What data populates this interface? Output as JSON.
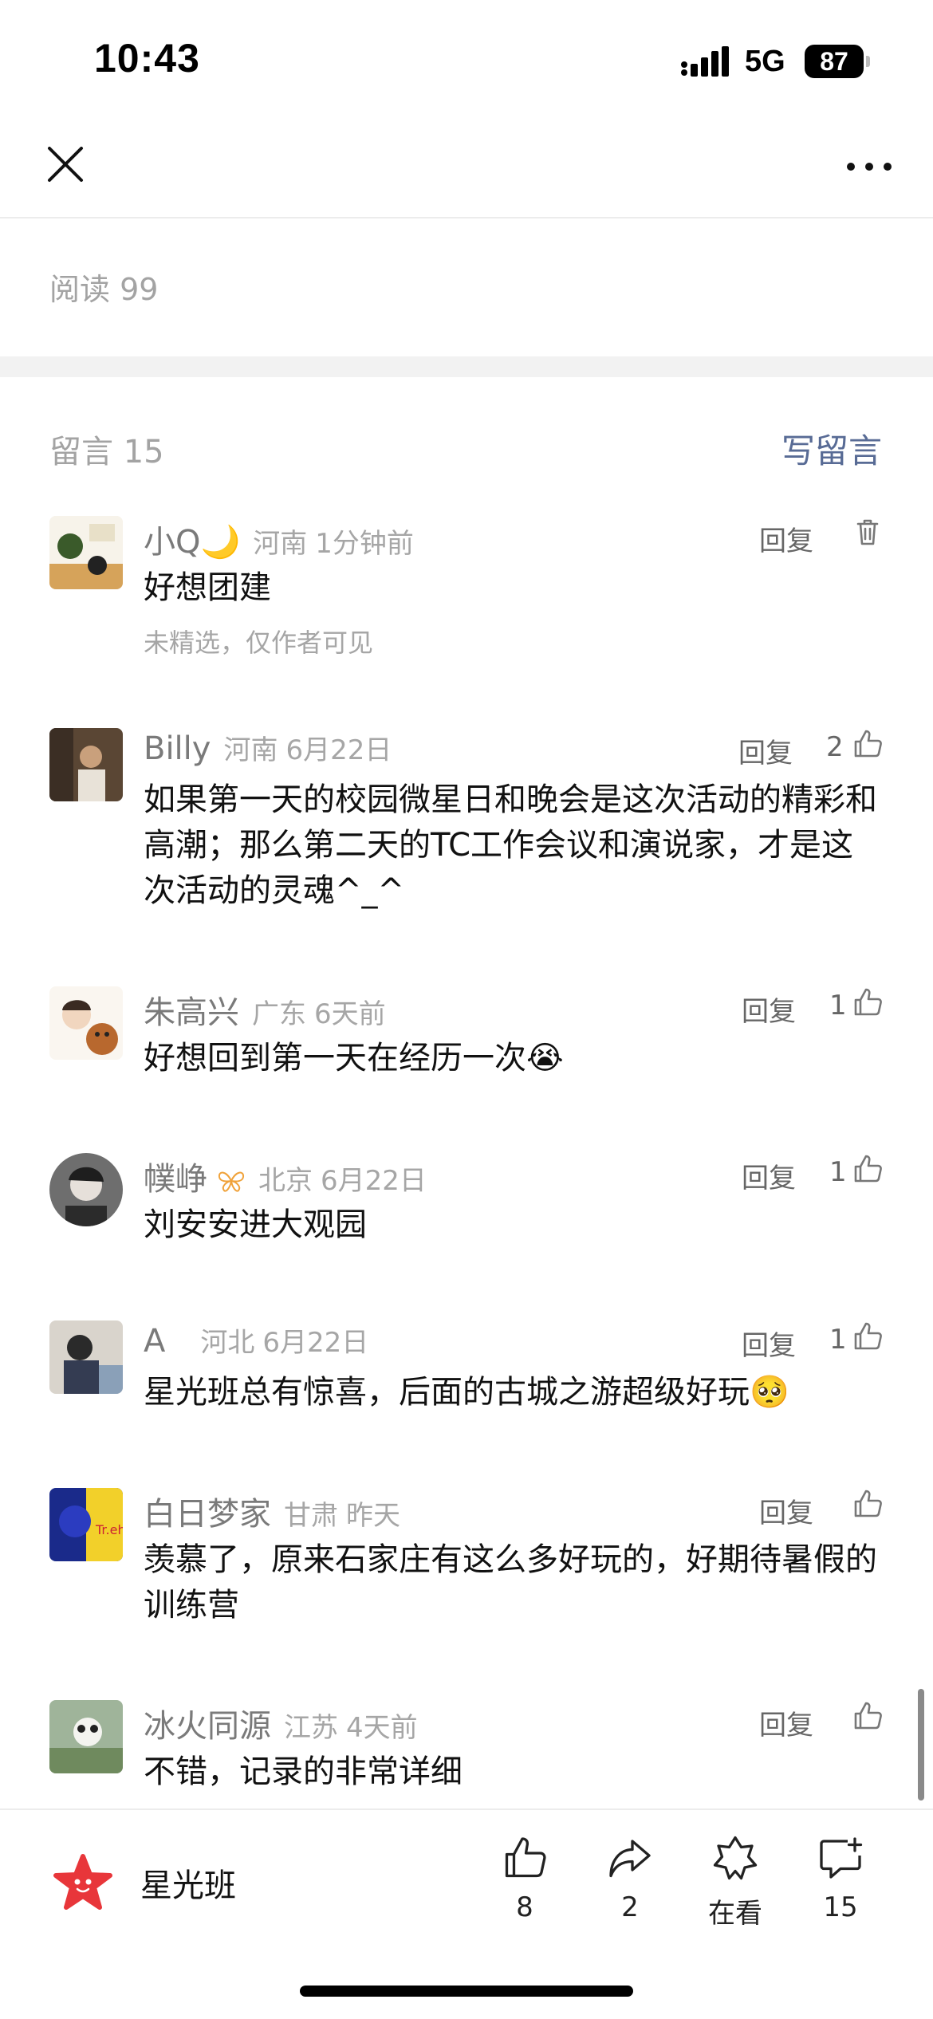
{
  "status_bar": {
    "time": "10:43",
    "network": "5G",
    "battery": "87"
  },
  "article": {
    "read_label": "阅读 99"
  },
  "comments_section": {
    "title": "留言 15",
    "write_label": "写留言",
    "comments": [
      {
        "name": "小Q🌙",
        "location": "河南",
        "time": "1分钟前",
        "reply": "回复",
        "likes": "",
        "text": "好想团建",
        "note": "未精选，仅作者可见"
      },
      {
        "name": "Billy",
        "location": "河南",
        "time": "6月22日",
        "reply": "回复",
        "likes": "2",
        "text": "如果第一天的校园微星日和晚会是这次活动的精彩和高潮；那么第二天的TC工作会议和演说家，才是这次活动的灵魂^_^"
      },
      {
        "name": "朱高兴",
        "location": "广东",
        "time": "6天前",
        "reply": "回复",
        "likes": "1",
        "text": "好想回到第一天在经历一次😭"
      },
      {
        "name": "幞峥",
        "location": "北京",
        "time": "6月22日",
        "reply": "回复",
        "likes": "1",
        "text": "刘安安进大观园"
      },
      {
        "name": "A",
        "location": "河北",
        "time": "6月22日",
        "reply": "回复",
        "likes": "1",
        "text": "星光班总有惊喜，后面的古城之游超级好玩🥺"
      },
      {
        "name": "白日梦家",
        "location": "甘肃",
        "time": "昨天",
        "reply": "回复",
        "likes": "",
        "text": "羡慕了，原来石家庄有这么多好玩的，好期待暑假的训练营"
      },
      {
        "name": "冰火同源",
        "location": "江苏",
        "time": "4天前",
        "reply": "回复",
        "likes": "",
        "text": "不错，记录的非常详细"
      }
    ]
  },
  "bottom_bar": {
    "account_name": "星光班",
    "like_count": "8",
    "share_count": "2",
    "watching_label": "在看",
    "comment_count": "15"
  },
  "colors": {
    "link": "#586b95",
    "muted": "#a6a6a6",
    "brand_red": "#e8363a"
  },
  "icons": [
    "close-icon",
    "more-icon",
    "trash-icon",
    "thumbs-up-icon",
    "share-icon",
    "watching-icon",
    "comment-add-icon",
    "moon-icon",
    "verified-butterfly-icon"
  ]
}
